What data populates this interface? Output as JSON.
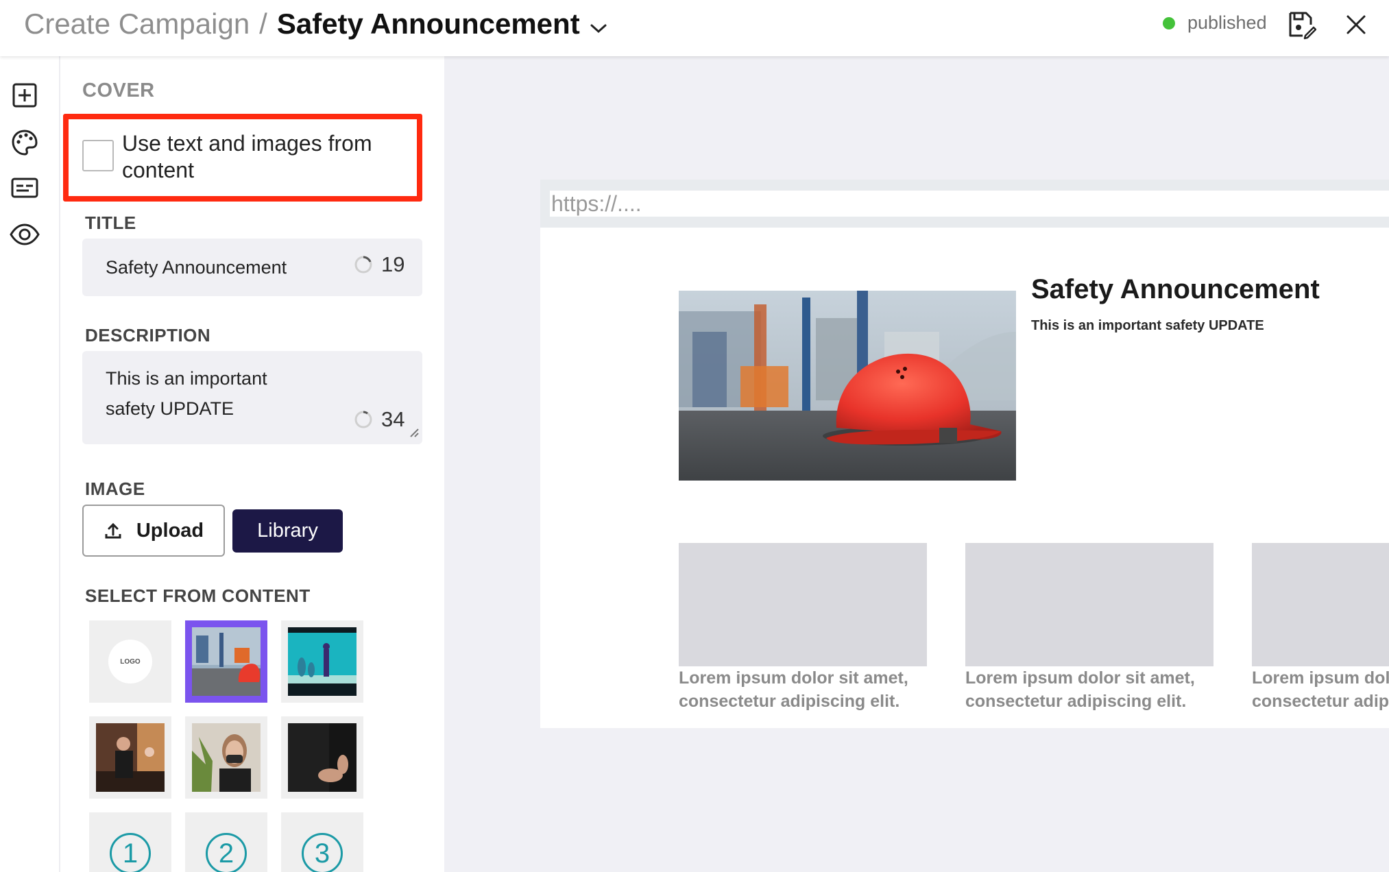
{
  "header": {
    "breadcrumb_parent": "Create Campaign",
    "separator": "/",
    "title": "Safety Announcement",
    "status_text": "published",
    "status_color": "#44c23a",
    "icons": [
      "chevron-down-icon",
      "save-icon",
      "close-icon"
    ]
  },
  "rail": {
    "icons": [
      "add-icon",
      "palette-icon",
      "subtitles-icon",
      "eye-icon"
    ]
  },
  "panel": {
    "cover_label": "COVER",
    "use_content_label": "Use text and images from content",
    "use_content_checked": false,
    "title_label": "TITLE",
    "title_value": "Safety Announcement",
    "title_remaining": "19",
    "description_label": "DESCRIPTION",
    "description_value": "This is an important safety UPDATE",
    "description_remaining": "34",
    "image_label": "IMAGE",
    "upload_label": "Upload",
    "library_label": "Library",
    "select_label": "SELECT FROM CONTENT",
    "logo_text": "LOGO",
    "step_numbers": [
      "1",
      "2",
      "3"
    ],
    "selected_thumb": "hardhat-thumb"
  },
  "preview": {
    "url_placeholder": "https://....",
    "title": "Safety Announcement",
    "description": "This is an important safety UPDATE",
    "tile_line1": "Lorem ipsum dolor sit amet,",
    "tile_line2": "consectetur adipiscing elit."
  },
  "colors": {
    "highlight": "#ff2a10",
    "library_button": "#1c1846",
    "selected_thumb_border": "#7b54ee",
    "step_accent": "#1b9aa6"
  }
}
